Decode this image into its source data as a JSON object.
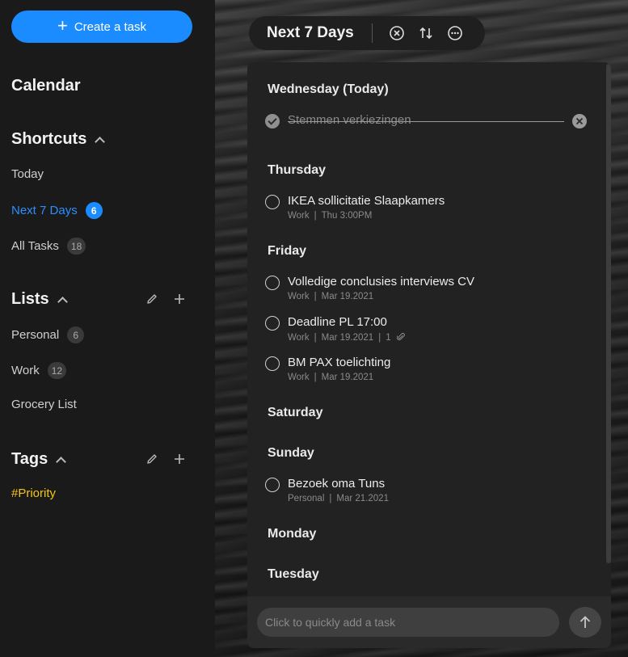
{
  "sidebar": {
    "create_label": "Create a task",
    "calendar_label": "Calendar",
    "shortcuts_label": "Shortcuts",
    "shortcuts": [
      {
        "label": "Today",
        "count": null
      },
      {
        "label": "Next 7 Days",
        "count": "6",
        "active": true
      },
      {
        "label": "All Tasks",
        "count": "18"
      }
    ],
    "lists_label": "Lists",
    "lists": [
      {
        "label": "Personal",
        "count": "6"
      },
      {
        "label": "Work",
        "count": "12"
      },
      {
        "label": "Grocery List",
        "count": null
      }
    ],
    "tags_label": "Tags",
    "tags": [
      {
        "label": "#Priority",
        "color": "#f3c614"
      }
    ]
  },
  "header": {
    "title": "Next 7 Days"
  },
  "days": [
    {
      "label": "Wednesday (Today)"
    },
    {
      "label": "Thursday"
    },
    {
      "label": "Friday"
    },
    {
      "label": "Saturday"
    },
    {
      "label": "Sunday"
    },
    {
      "label": "Monday"
    },
    {
      "label": "Tuesday"
    }
  ],
  "tasks": [
    {
      "title": "Stemmen verkiezingen",
      "completed": true
    },
    {
      "title": "IKEA sollicitatie Slaapkamers",
      "list": "Work",
      "due": "Thu 3:00PM"
    },
    {
      "title": "Volledige conclusies interviews CV",
      "list": "Work",
      "due": "Mar 19.2021"
    },
    {
      "title": "Deadline PL 17:00",
      "list": "Work",
      "due": "Mar 19.2021",
      "attachments": "1"
    },
    {
      "title": "BM PAX toelichting",
      "list": "Work",
      "due": "Mar 19.2021"
    },
    {
      "title": "Bezoek oma Tuns",
      "list": "Personal",
      "due": "Mar 21.2021"
    }
  ],
  "quick_add": {
    "placeholder": "Click to quickly add a task"
  },
  "colors": {
    "accent": "#1a8cff",
    "tag": "#f3c614"
  }
}
